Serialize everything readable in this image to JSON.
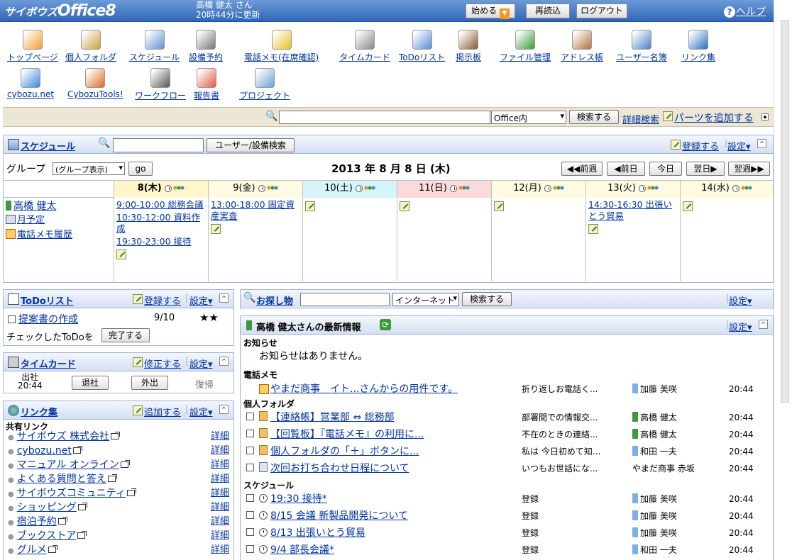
{
  "header": {
    "logo_prefix": "サイボウズ",
    "logo_main": "Office8",
    "user_name": "高橋 健太 さん",
    "updated": "20時44分に更新",
    "start_btn": "始める",
    "reload_btn": "再読込",
    "logout_btn": "ログアウト",
    "help_label": "ヘルプ"
  },
  "apps": [
    {
      "label": "トップページ",
      "icon": "house-icon"
    },
    {
      "label": "個人フォルダ",
      "icon": "folder-icon"
    },
    {
      "label": "スケジュール",
      "icon": "calendar-icon"
    },
    {
      "label": "設備予約",
      "icon": "equipment-icon"
    },
    {
      "label": "電話メモ(在席確認)",
      "icon": "phone-memo-icon"
    },
    {
      "label": "タイムカード",
      "icon": "timecard-icon"
    },
    {
      "label": "ToDoリスト",
      "icon": "todo-icon"
    },
    {
      "label": "掲示板",
      "icon": "bulletin-icon"
    },
    {
      "label": "ファイル管理",
      "icon": "file-icon"
    },
    {
      "label": "アドレス帳",
      "icon": "address-book-icon"
    },
    {
      "label": "ユーザー名簿",
      "icon": "user-list-icon"
    },
    {
      "label": "リンク集",
      "icon": "globe-icon"
    },
    {
      "label": "cybozu.net",
      "icon": "speech-bubble-icon"
    },
    {
      "label": "CybozuTools!",
      "icon": "tools-icon"
    },
    {
      "label": "ワークフロー",
      "icon": "stamp-icon"
    },
    {
      "label": "報告書",
      "icon": "report-icon"
    },
    {
      "label": "プロジェクト",
      "icon": "project-icon"
    }
  ],
  "search": {
    "value": "",
    "scope": "Office内",
    "submit": "検索する",
    "advanced": "詳細検索",
    "add_parts": "パーツを追加する"
  },
  "schedule": {
    "title": "スケジュール",
    "search_value": "",
    "user_search": "ユーザー/設備検索",
    "register": "登録する",
    "settings": "設定",
    "group_label": "グループ",
    "group_select": "(グループ表示)",
    "go": "go",
    "date_title": "2013 年 8 月 8 日 (木)",
    "nav": {
      "prev_week": "前週",
      "prev_day": "前日",
      "today": "今日",
      "next_day": "翌日",
      "next_week": "翌週"
    },
    "days": [
      "8(木)",
      "9(金)",
      "10(土)",
      "11(日)",
      "12(月)",
      "13(火)",
      "14(水)"
    ],
    "user": "高橋 健太",
    "month_plan": "月予定",
    "phone_history": "電話メモ履歴",
    "events": {
      "d0": [
        "9:00-10:00 総務会議",
        "10:30-12:00 資料作成",
        "19:30-23:00 接待"
      ],
      "d1": [
        "13:00-18:00 固定資産実査"
      ],
      "d5": [
        "14:30-16:30 出張いとう貿易"
      ]
    }
  },
  "todo": {
    "title": "ToDoリスト",
    "register": "登録する",
    "settings": "設定",
    "item": "提案書の作成",
    "date": "9/10",
    "priority": "★★",
    "done_label": "チェックしたToDoを",
    "done_btn": "完了する"
  },
  "timecard": {
    "title": "タイムカード",
    "edit": "修正する",
    "settings": "設定",
    "in_label": "出社",
    "in_time": "20:44",
    "out_btn": "退社",
    "away_btn": "外出",
    "return_label": "復帰"
  },
  "links": {
    "title": "リンク集",
    "add": "追加する",
    "settings": "設定",
    "group": "共有リンク",
    "detail": "詳細",
    "items": [
      "サイボウズ 株式会社",
      "cybozu.net",
      "マニュアル オンライン",
      "よくある質問と答え",
      "サイボウズコミュニティ",
      "ショッピング",
      "宿泊予約",
      "ブックストア",
      "グルメ"
    ]
  },
  "finder": {
    "title": "お探し物",
    "value": "",
    "scope": "インターネット",
    "submit": "検索する",
    "settings": "設定"
  },
  "news": {
    "title": "高橋 健太さんの最新情報",
    "settings": "設定",
    "notice_label": "お知らせ",
    "notice_text": "お知らせはありません。",
    "phone_label": "電話メモ",
    "phone": {
      "title": "やまだ商事　イト...さんからの用件です。",
      "desc": "折り返しお電話く...",
      "person": "加藤 美咲",
      "time": "20:44"
    },
    "folder_label": "個人フォルダ",
    "folder": [
      {
        "title": "【連絡帳】営業部 ⇔ 総務部",
        "desc": "部署間での情報交...",
        "person": "高橋 健太",
        "time": "20:44",
        "pc": "g"
      },
      {
        "title": "【回覧板】『電話メモ』の利用に...",
        "desc": "不在のときの連絡...",
        "person": "高橋 健太",
        "time": "20:44",
        "pc": "g"
      },
      {
        "title": "個人フォルダの「＋」ボタンに...",
        "desc": "私は 今日初めて知...",
        "person": "和田 一夫",
        "time": "20:44",
        "pc": "b"
      },
      {
        "title": "次回お打ち合わせ日程について",
        "desc": "いつもお世話にな...",
        "person": "やまだ商事 赤坂",
        "time": "20:44",
        "pc": ""
      }
    ],
    "sched_label": "スケジュール",
    "sched": [
      {
        "title": "19:30 接待*",
        "desc": "登録",
        "person": "加藤 美咲",
        "time": "20:44"
      },
      {
        "title": "8/15 会議 新製品開発について",
        "desc": "登録",
        "person": "加藤 美咲",
        "time": "20:44"
      },
      {
        "title": "8/13 出張いとう貿易",
        "desc": "登録",
        "person": "加藤 美咲",
        "time": "20:44"
      },
      {
        "title": "9/4 部長会議*",
        "desc": "登録",
        "person": "和田 一夫",
        "time": "20:44"
      }
    ]
  }
}
